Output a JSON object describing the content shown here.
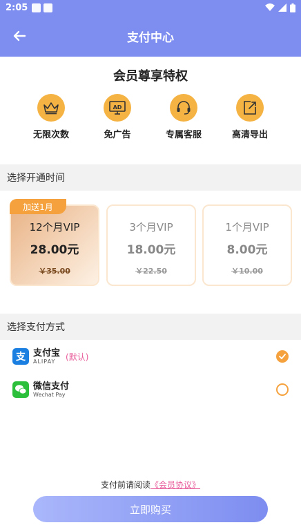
{
  "status_bar": {
    "time": "2:05"
  },
  "header": {
    "title": "支付中心"
  },
  "privileges": {
    "title": "会员尊享特权",
    "items": [
      {
        "label": "无限次数",
        "icon": "crown-icon"
      },
      {
        "label": "免广告",
        "icon": "ad-icon"
      },
      {
        "label": "专属客服",
        "icon": "headset-icon"
      },
      {
        "label": "高清导出",
        "icon": "export-icon"
      }
    ]
  },
  "plan_section": {
    "title": "选择开通时间"
  },
  "plans": [
    {
      "name": "12个月VIP",
      "price": "28.00元",
      "original": "￥35.00",
      "badge": "加送1月",
      "selected": true
    },
    {
      "name": "3个月VIP",
      "price": "18.00元",
      "original": "￥22.50",
      "selected": false
    },
    {
      "name": "1个月VIP",
      "price": "8.00元",
      "original": "￥10.00",
      "selected": false
    }
  ],
  "pay_section": {
    "title": "选择支付方式"
  },
  "payments": [
    {
      "name": "支付宝",
      "sub": "ALIPAY",
      "note": "(默认)",
      "selected": true,
      "icon": "alipay-icon",
      "color": "#1a7fe0"
    },
    {
      "name": "微信支付",
      "sub": "Wechat Pay",
      "note": "",
      "selected": false,
      "icon": "wechat-pay-icon",
      "color": "#2bbf3b"
    }
  ],
  "agreement": {
    "prefix": "支付前请阅读",
    "link": "《会员协议》"
  },
  "buy_button": {
    "label": "立即购买"
  },
  "colors": {
    "accent": "#7d8df0",
    "orange": "#f5a23e",
    "pink": "#e85c9a"
  }
}
